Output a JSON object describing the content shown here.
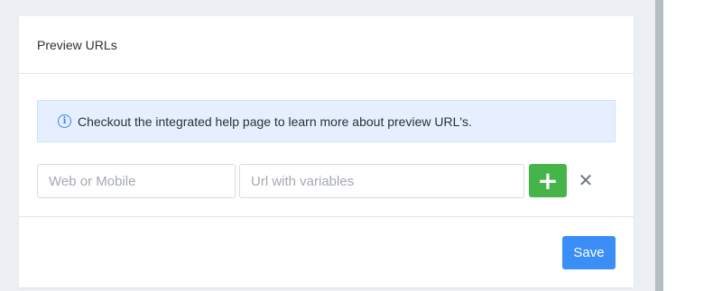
{
  "card": {
    "title": "Preview URLs"
  },
  "info": {
    "icon": "info-icon",
    "message": "Checkout the integrated help page to learn more about preview URL's."
  },
  "form": {
    "type_placeholder": "Web or Mobile",
    "url_placeholder": "Url with variables",
    "add_symbol": "+",
    "remove_symbol": "✕"
  },
  "footer": {
    "save_label": "Save"
  },
  "colors": {
    "accent": "#3a8ef6",
    "add_green": "#45b549",
    "info_bg": "#e6efff"
  }
}
